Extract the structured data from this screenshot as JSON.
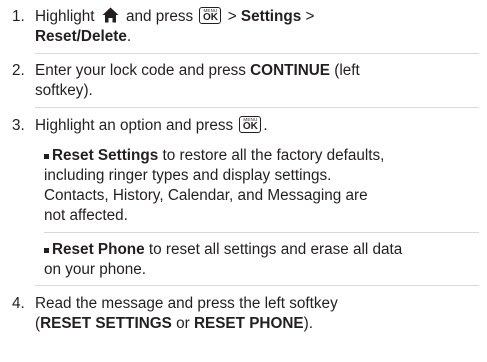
{
  "steps": [
    {
      "num": "1.",
      "l1_a": "Highlight",
      "l1_b": "and press",
      "l1_c": "> ",
      "l1_settings": "Settings",
      "l1_d": " >",
      "l2_reset": "Reset/Delete",
      "l2_end": "."
    },
    {
      "num": "2.",
      "l1_a": "Enter your lock code and press ",
      "l1_continue": "CONTINUE",
      "l1_b": " (left",
      "l2": "softkey)."
    },
    {
      "num": "3.",
      "l1_a": "Highlight an option and press",
      "l1_end": "."
    },
    {
      "num": "4.",
      "l1": "Read the message and press the left softkey",
      "l2_open": "(",
      "l2_rs": "RESET SETTINGS",
      "l2_or": " or ",
      "l2_rp": "RESET PHONE",
      "l2_close": ")."
    }
  ],
  "bullets": [
    {
      "title": "Reset Settings",
      "l1_rest": " to restore all the factory defaults,",
      "l2": "including ringer types and display settings.",
      "l3": "Contacts, History, Calendar, and Messaging are",
      "l4": "not affected."
    },
    {
      "title": "Reset Phone",
      "l1_rest": " to reset all settings and erase all data",
      "l2": "on your phone."
    }
  ],
  "key": {
    "top": "MENU",
    "bottom": "OK"
  },
  "icons": {
    "home": "home-icon",
    "key": "menu-ok-key-icon"
  }
}
